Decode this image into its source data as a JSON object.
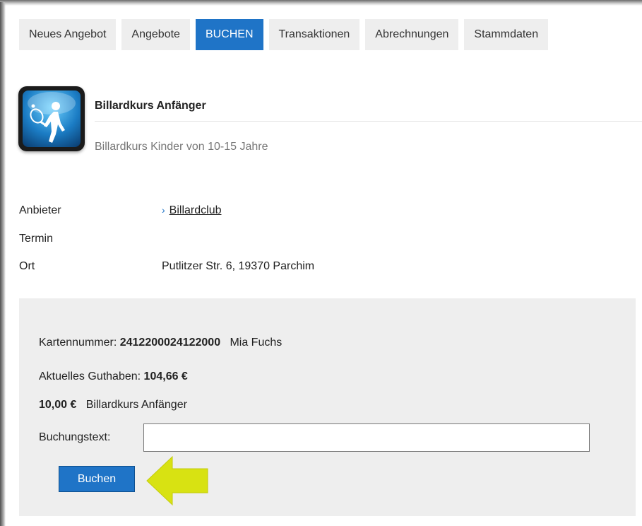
{
  "tabs": [
    {
      "label": "Neues Angebot"
    },
    {
      "label": "Angebote"
    },
    {
      "label": "BUCHEN"
    },
    {
      "label": "Transaktionen"
    },
    {
      "label": "Abrechnungen"
    },
    {
      "label": "Stammdaten"
    }
  ],
  "offer": {
    "title": "Billardkurs Anfänger",
    "description": "Billardkurs Kinder von 10-15 Jahre",
    "icon": "sport-person-icon"
  },
  "details": {
    "provider_label": "Anbieter",
    "provider_value": "Billardclub",
    "date_label": "Termin",
    "date_value": "",
    "location_label": "Ort",
    "location_value": "Putlitzer Str. 6, 19370 Parchim"
  },
  "booking": {
    "card_label": "Kartennummer:",
    "card_number": "2412200024122000",
    "card_holder": "Mia Fuchs",
    "balance_label": "Aktuelles Guthaben:",
    "balance_value": "104,66 €",
    "price": "10,00 €",
    "price_item": "Billardkurs Anfänger",
    "text_label": "Buchungstext:",
    "text_value": "",
    "button_label": "Buchen"
  },
  "colors": {
    "accent": "#1f74c7",
    "arrow": "#d8e212"
  }
}
